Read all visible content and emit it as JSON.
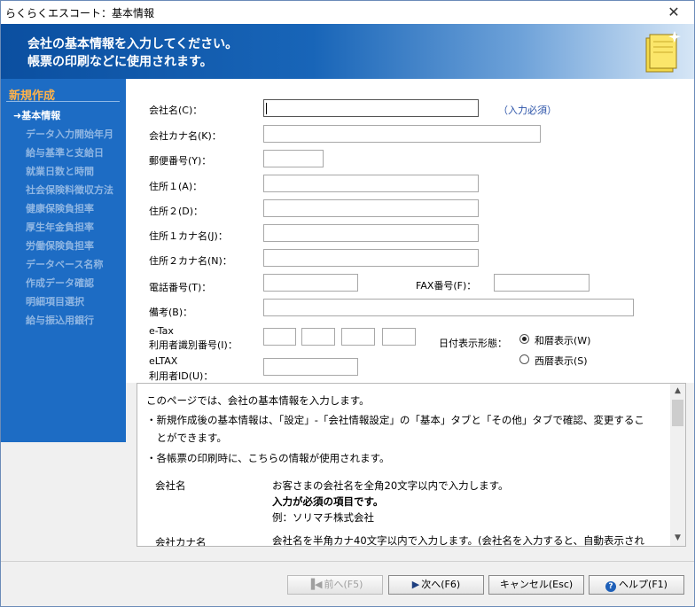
{
  "window": {
    "title": "らくらくエスコート：基本情報",
    "close_glyph": "✕"
  },
  "header": {
    "line1": "会社の基本情報を入力してください。",
    "line2": "帳票の印刷などに使用されます。"
  },
  "sidebar": {
    "section": "新規作成",
    "items": [
      "➜基本情報",
      "データ入力開始年月",
      "給与基準と支給日",
      "就業日数と時間",
      "社会保険料徴収方法",
      "健康保険負担率",
      "厚生年金負担率",
      "労働保険負担率",
      "データベース名称",
      "作成データ確認",
      "明細項目選択",
      "給与振込用銀行"
    ]
  },
  "form": {
    "company_name": "会社名(C)：",
    "required": "（入力必須）",
    "company_kana": "会社カナ名(K)：",
    "postal": "郵便番号(Y)：",
    "address1": "住所１(A)：",
    "address2": "住所２(D)：",
    "address1_kana": "住所１カナ名(J)：",
    "address2_kana": "住所２カナ名(N)：",
    "phone": "電話番号(T)：",
    "fax": "FAX番号(F)：",
    "note": "備考(B)：",
    "etax_line1": "e-Tax",
    "etax_line2": "利用者識別番号(I)：",
    "eltax_line1": "eLTAX",
    "eltax_line2": "利用者ID(U)：",
    "date_format": "日付表示形態：",
    "wareki": "和暦表示(W)",
    "seireki": "西暦表示(S)"
  },
  "help": {
    "p1": "このページでは、会社の基本情報を入力します。",
    "p2a": "・新規作成後の基本情報は、「設定」-「会社情報設定」の「基本」タブと「その他」タブで確認、変更するこ",
    "p2b": "　とができます。",
    "p3": "・各帳票の印刷時に、こちらの情報が使用されます。",
    "r1_label": "会社名",
    "r1_desc": "お客さまの会社名を全角20文字以内で入力します。",
    "r1_bold": "入力が必須の項目です。",
    "r1_example": "例：ソリマチ株式会社",
    "r2_label": "会社カナ名",
    "r2_desc": "会社名を半角カナ40文字以内で入力します。(会社名を入力すると、自動表示され"
  },
  "buttons": {
    "prev": "前へ(F5)",
    "next": "次へ(F6)",
    "cancel": "キャンセル(Esc)",
    "help": "ヘルプ(F1)"
  },
  "colors": {
    "sidebar_bg": "#1d6cc4",
    "sidebar_section": "#ffb24a",
    "required_text": "#2a52a8"
  }
}
